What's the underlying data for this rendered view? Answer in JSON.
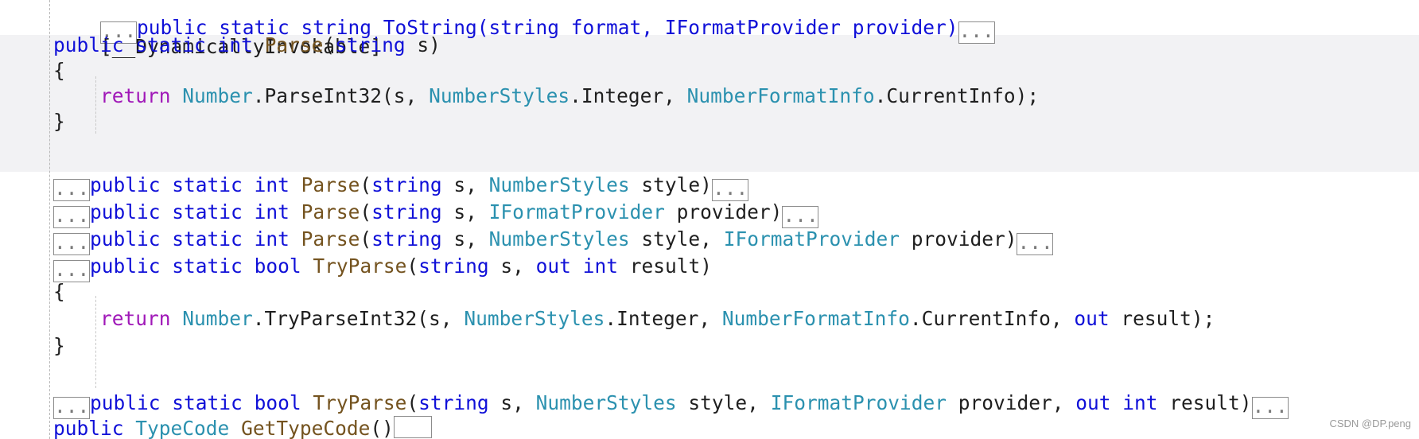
{
  "fold_marker": "...",
  "lines": {
    "l0": {
      "text": "public static string ToString(string format, IFormatProvider provider)"
    },
    "l1": {
      "attr": "[__DynamicallyInvokable]"
    },
    "l2": {
      "kw1": "public",
      "kw2": "static",
      "kw3": "int",
      "meth": "Parse",
      "open": "(",
      "kw4": "string",
      "rest": " s)"
    },
    "l3": {
      "brace": "{"
    },
    "l4": {
      "ret": "return",
      "type1": "Number",
      "mid1": ".ParseInt32(s, ",
      "type2": "NumberStyles",
      "mid2": ".Integer, ",
      "type3": "NumberFormatInfo",
      "end": ".CurrentInfo);"
    },
    "l5": {
      "brace": "}"
    },
    "l6": {
      "kw1": "public",
      "kw2": "static",
      "kw3": "int",
      "meth": "Parse",
      "open": "(",
      "kw4": "string",
      "p1": " s, ",
      "type1": "NumberStyles",
      "end": " style)"
    },
    "l7": {
      "kw1": "public",
      "kw2": "static",
      "kw3": "int",
      "meth": "Parse",
      "open": "(",
      "kw4": "string",
      "p1": " s, ",
      "type1": "IFormatProvider",
      "end": " provider)"
    },
    "l8": {
      "kw1": "public",
      "kw2": "static",
      "kw3": "int",
      "meth": "Parse",
      "open": "(",
      "kw4": "string",
      "p1": " s, ",
      "type1": "NumberStyles",
      "p2": " style, ",
      "type2": "IFormatProvider",
      "end": " provider)"
    },
    "l9": {
      "kw1": "public",
      "kw2": "static",
      "kw3": "bool",
      "meth": "TryParse",
      "open": "(",
      "kw4": "string",
      "p1": " s, ",
      "kw5": "out",
      "kw6": "int",
      "end": " result)"
    },
    "l10": {
      "brace": "{"
    },
    "l11": {
      "ret": "return",
      "type1": "Number",
      "mid1": ".TryParseInt32(s, ",
      "type2": "NumberStyles",
      "mid2": ".Integer, ",
      "type3": "NumberFormatInfo",
      "mid3": ".CurrentInfo, ",
      "kw1": "out",
      "end": " result);"
    },
    "l12": {
      "brace": "}"
    },
    "l13": {
      "kw1": "public",
      "kw2": "static",
      "kw3": "bool",
      "meth": "TryParse",
      "open": "(",
      "kw4": "string",
      "p1": " s, ",
      "type1": "NumberStyles",
      "p2": " style, ",
      "type2": "IFormatProvider",
      "p3": " provider, ",
      "kw5": "out",
      "kw6": "int",
      "end": " result)"
    },
    "l14": {
      "kw1": "public",
      "type1": "TypeCode",
      "meth": "GetTypeCode",
      "end": "()"
    }
  },
  "watermark": "CSDN @DP.peng",
  "colors": {
    "keyword": "#1010d8",
    "control_keyword": "#a018b8",
    "type": "#2b91af",
    "method": "#74531f",
    "highlight_band": "#f2f2f4"
  }
}
